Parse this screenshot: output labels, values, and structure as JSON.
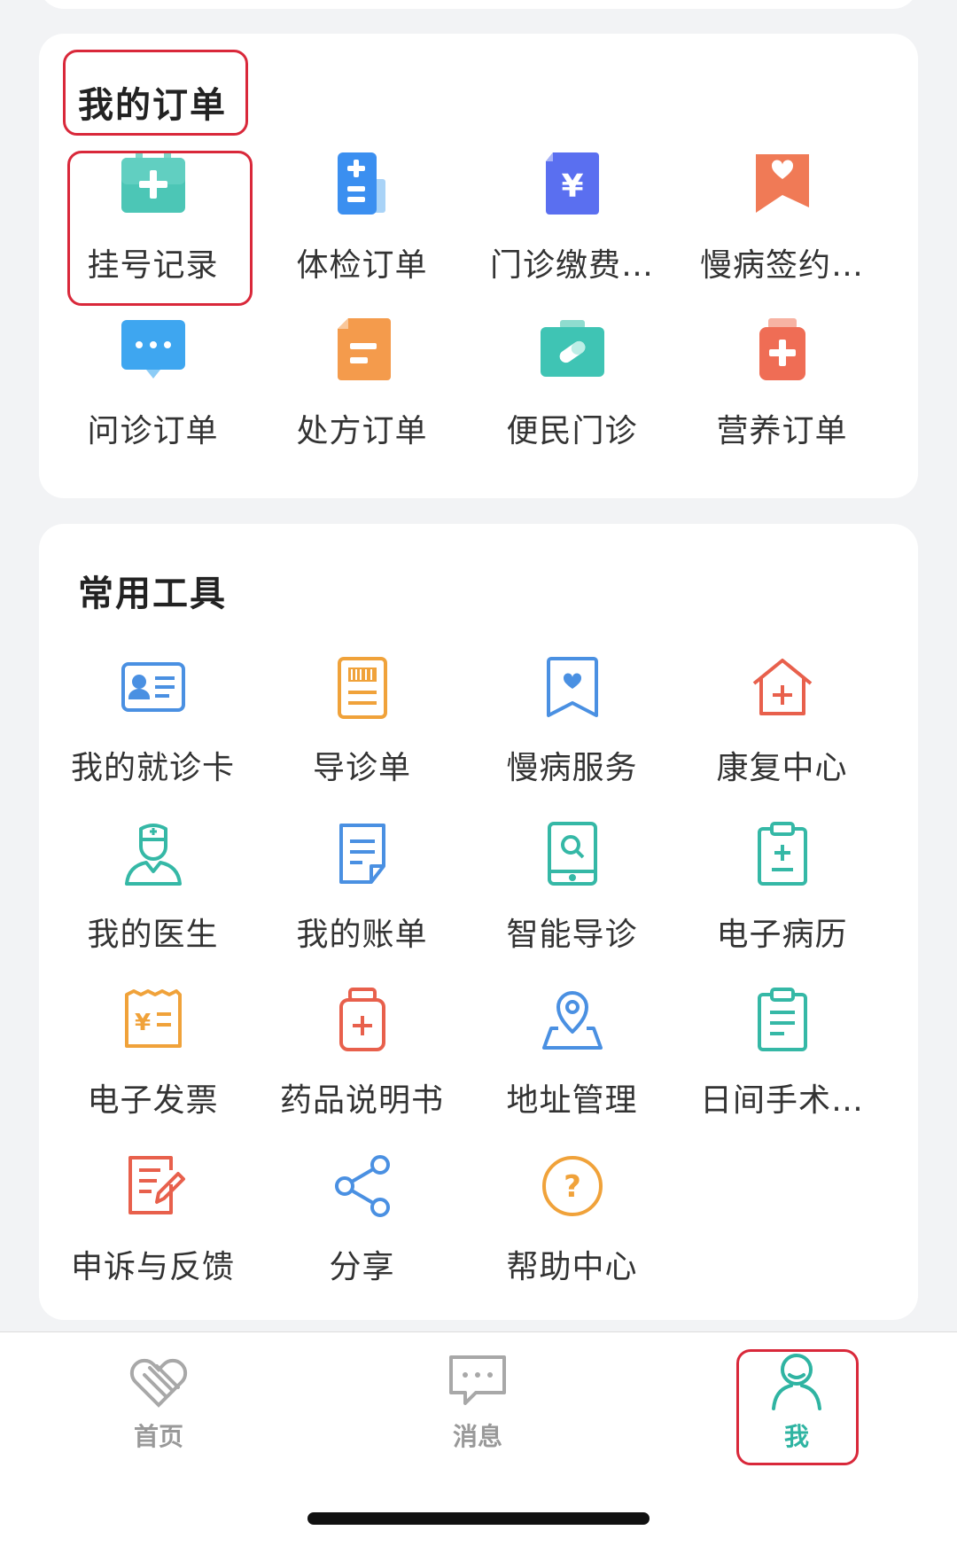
{
  "orders": {
    "title": "我的订单",
    "items": [
      {
        "label": "挂号记录",
        "icon": "registration-icon"
      },
      {
        "label": "体检订单",
        "icon": "checkup-icon"
      },
      {
        "label": "门诊缴费…",
        "icon": "outpatient-payment-icon"
      },
      {
        "label": "慢病签约…",
        "icon": "chronic-contract-icon"
      },
      {
        "label": "问诊订单",
        "icon": "consultation-icon"
      },
      {
        "label": "处方订单",
        "icon": "prescription-icon"
      },
      {
        "label": "便民门诊",
        "icon": "convenience-clinic-icon"
      },
      {
        "label": "营养订单",
        "icon": "nutrition-icon"
      }
    ]
  },
  "tools": {
    "title": "常用工具",
    "items": [
      {
        "label": "我的就诊卡",
        "icon": "id-card-icon"
      },
      {
        "label": "导诊单",
        "icon": "barcode-sheet-icon"
      },
      {
        "label": "慢病服务",
        "icon": "heart-bookmark-icon"
      },
      {
        "label": "康复中心",
        "icon": "home-plus-icon"
      },
      {
        "label": "我的医生",
        "icon": "doctor-icon"
      },
      {
        "label": "我的账单",
        "icon": "bill-icon"
      },
      {
        "label": "智能导诊",
        "icon": "tablet-search-icon"
      },
      {
        "label": "电子病历",
        "icon": "clipboard-plus-icon"
      },
      {
        "label": "电子发票",
        "icon": "invoice-icon"
      },
      {
        "label": "药品说明书",
        "icon": "medicine-bottle-icon"
      },
      {
        "label": "地址管理",
        "icon": "location-pin-icon"
      },
      {
        "label": "日间手术…",
        "icon": "clipboard-list-icon"
      },
      {
        "label": "申诉与反馈",
        "icon": "feedback-icon"
      },
      {
        "label": "分享",
        "icon": "share-icon"
      },
      {
        "label": "帮助中心",
        "icon": "help-icon"
      }
    ]
  },
  "tabbar": {
    "home": "首页",
    "messages": "消息",
    "me": "我",
    "active": "me"
  },
  "colors": {
    "highlight": "#d9283a",
    "accent": "#2fb4a2",
    "icon_blue": "#4a90e2",
    "icon_orange": "#f0a23a",
    "icon_red": "#e8604c",
    "icon_teal": "#35b8a6"
  }
}
